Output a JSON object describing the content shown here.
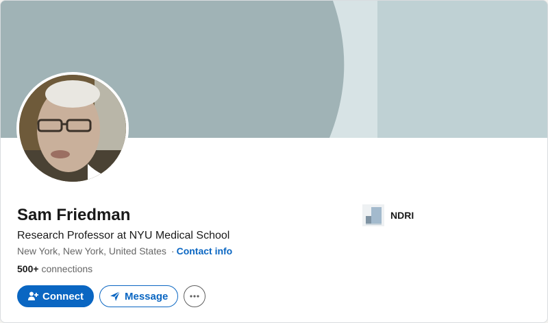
{
  "profile": {
    "name": "Sam Friedman",
    "headline": "Research Professor at NYU Medical School",
    "location": "New York, New York, United States",
    "separator": "·",
    "contact_info": "Contact info",
    "connections_count": "500+",
    "connections_label": "connections"
  },
  "company": {
    "name": "NDRI",
    "logo_icon": "company-logo-icon"
  },
  "actions": {
    "connect_label": "Connect",
    "connect_icon": "add-person-icon",
    "message_label": "Message",
    "message_icon": "paper-plane-icon",
    "more_icon": "more-horizontal-icon"
  },
  "colors": {
    "accent": "#0a66c2",
    "banner_light": "#bfd1d4",
    "banner_dark": "#a0b3b6",
    "banner_stripe": "#d7e3e5"
  }
}
